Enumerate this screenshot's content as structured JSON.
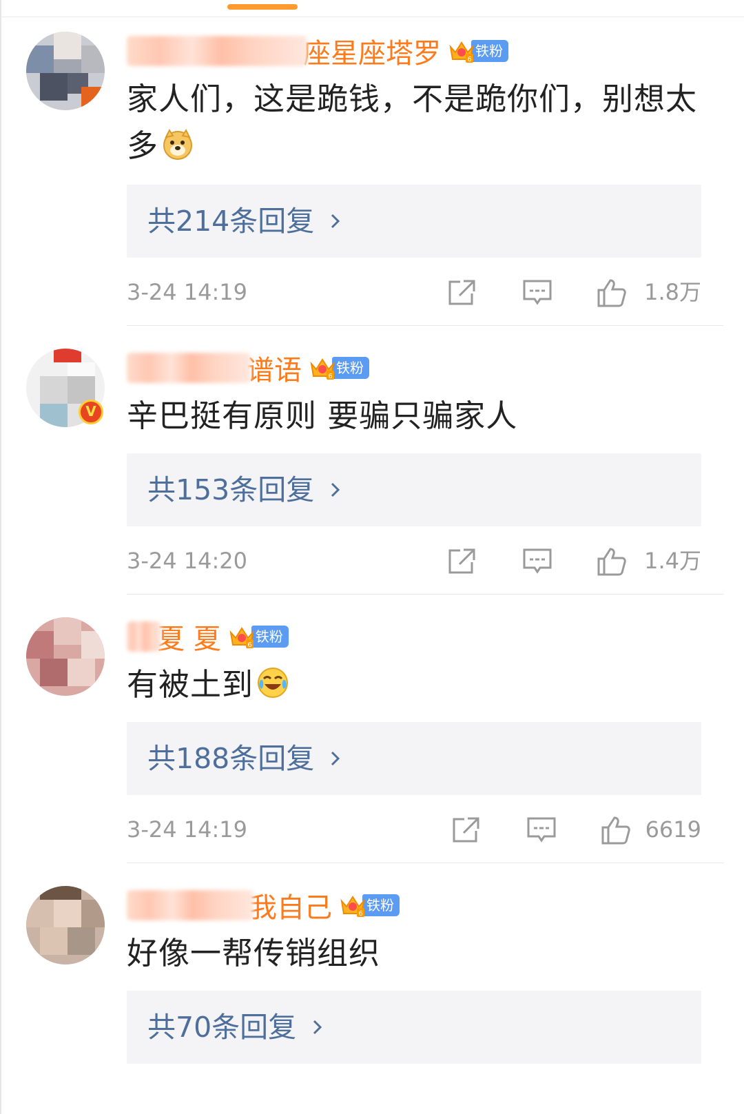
{
  "colors": {
    "accent_orange": "#ff7a1a",
    "reply_link_blue": "#4e6f9c",
    "fan_badge_blue": "#5b9cf2",
    "meta_gray": "#9a9a9a"
  },
  "icons": {
    "share": "share-icon",
    "comment": "comment-icon",
    "like": "like-icon",
    "fan": "crown-icon"
  },
  "comments": [
    {
      "user_name": "座星座塔罗",
      "fan_badge": "铁粉",
      "text": "家人们，这是跪钱，不是跪你们，别想太多",
      "emoji": "doge-emoji",
      "reply_link": "共214条回复",
      "timestamp": "3-24 14:19",
      "likes": "1.8万"
    },
    {
      "user_name": "谱语",
      "fan_badge": "铁粉",
      "text": "辛巴挺有原则 要骗只骗家人",
      "emoji": "",
      "reply_link": "共153条回复",
      "timestamp": "3-24 14:20",
      "likes": "1.4万"
    },
    {
      "user_name": "夏 夏",
      "fan_badge": "铁粉",
      "text": "有被土到",
      "emoji": "laugh-cry-emoji",
      "reply_link": "共188条回复",
      "timestamp": "3-24 14:19",
      "likes": "6619"
    },
    {
      "user_name": "我自己",
      "fan_badge": "铁粉",
      "text": "好像一帮传销组织",
      "emoji": "",
      "reply_link": "共70条回复",
      "timestamp": "",
      "likes": ""
    }
  ]
}
